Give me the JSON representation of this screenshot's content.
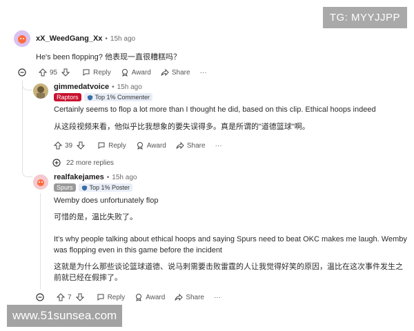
{
  "watermarks": {
    "top": "TG: MYYJJPP",
    "bottom": "www.51sunsea.com"
  },
  "comments": [
    {
      "username": "xX_WeedGang_Xx",
      "age": "15h ago",
      "lines": [
        "He's been flopping?  他表现一直很糟糕吗？"
      ],
      "votes": "95",
      "actions": {
        "reply": "Reply",
        "award": "Award",
        "share": "Share",
        "more": "···"
      }
    },
    {
      "username": "gimmedatvoice",
      "age": "15h ago",
      "flair": "Raptors",
      "badge": "Top 1% Commenter",
      "lines": [
        "Certainly seems to flop a lot more than I thought he did, based on this clip. Ethical hoops indeed",
        "从这段视频来看，他似乎比我想象的要失误得多。真是所谓的\"道德篮球\"啊。"
      ],
      "votes": "39",
      "actions": {
        "reply": "Reply",
        "award": "Award",
        "share": "Share",
        "more": "···"
      }
    },
    {
      "username": "realfakejames",
      "age": "15h ago",
      "flair": "Spurs",
      "badge": "Top 1% Poster",
      "lines": [
        "Wemby does unfortunately flop",
        "可惜的是，温比失败了。",
        "It's why people talking about ethical hoops and saying Spurs need to beat OKC makes me laugh. Wemby",
        "was flopping even in this game before the incident",
        "这就是为什么那些谈论篮球道德、说马刺需要击败雷霆的人让我觉得好笑的原因，温比在这次事件发生之",
        "前就已经在假摔了。"
      ],
      "votes": "7",
      "actions": {
        "reply": "Reply",
        "award": "Award",
        "share": "Share",
        "more": "···"
      }
    }
  ],
  "more_replies": "22 more replies",
  "colors": {
    "raptors": "#c8102e",
    "spurs": "#9a9a9a",
    "badge_bg": "#e8eef7"
  }
}
